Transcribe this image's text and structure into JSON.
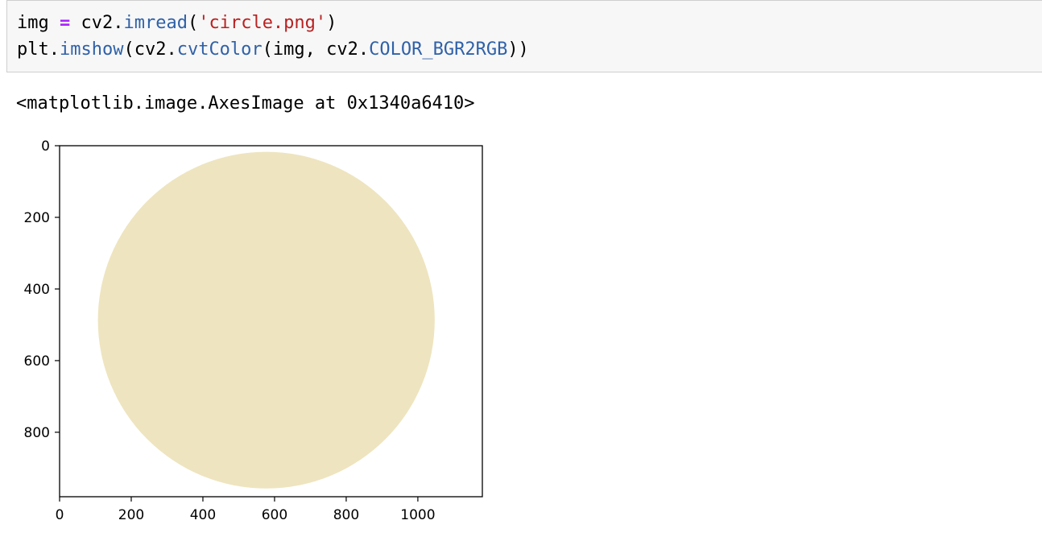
{
  "code_cell": {
    "line1": {
      "var": "img",
      "op": "=",
      "obj": "cv2.",
      "fn": "imread",
      "open": "(",
      "arg": "'circle.png'",
      "close": ")"
    },
    "line2": {
      "obj": "plt.",
      "fn": "imshow",
      "open": "(",
      "obj2": "cv2.",
      "fn2": "cvtColor",
      "args": "(img, cv2.",
      "const": "COLOR_BGR2RGB",
      "close": "))"
    }
  },
  "output": {
    "repr": "<matplotlib.image.AxesImage at 0x1340a6410>"
  },
  "chart_data": {
    "type": "image",
    "xlim": [
      0,
      1180
    ],
    "ylim": [
      980,
      0
    ],
    "x_ticks": [
      0,
      200,
      400,
      600,
      800,
      1000
    ],
    "y_ticks": [
      0,
      200,
      400,
      600,
      800
    ],
    "x_tick_labels": [
      "0",
      "200",
      "400",
      "600",
      "800",
      "1000"
    ],
    "y_tick_labels": [
      "0",
      "200",
      "400",
      "600",
      "800"
    ],
    "circle": {
      "cx": 577,
      "cy": 487,
      "r": 470,
      "color": "#eee4bf"
    },
    "axis_color": "#000000",
    "background": "#ffffff",
    "grid": false
  }
}
